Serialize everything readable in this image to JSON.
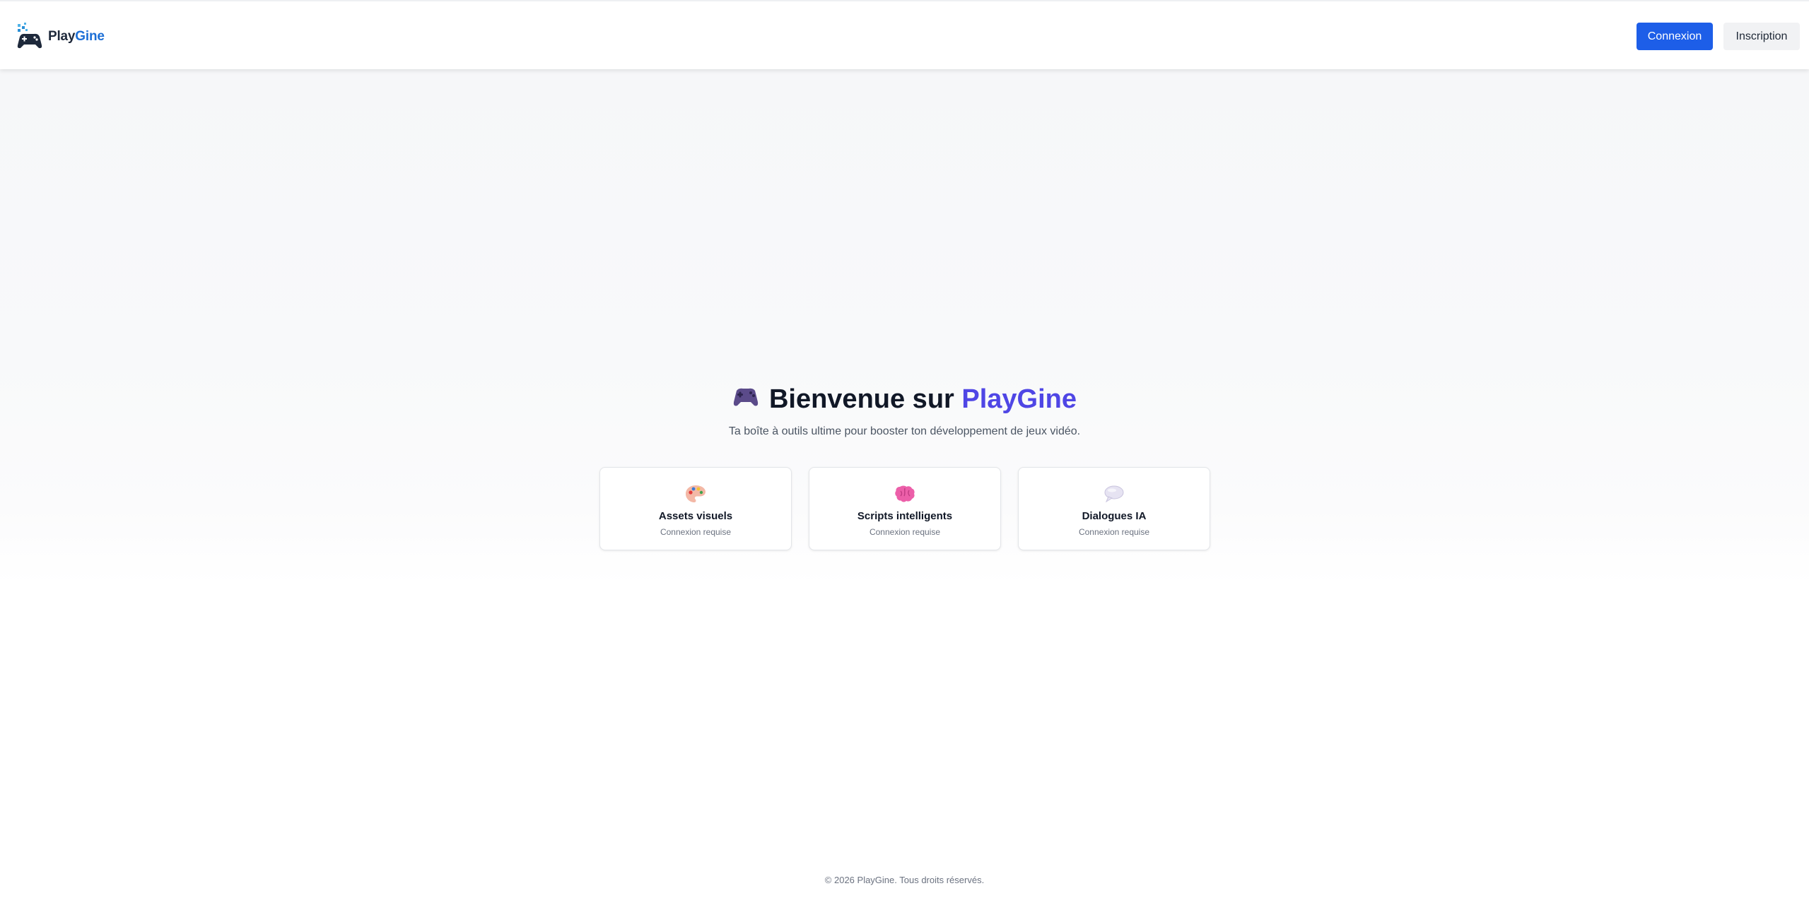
{
  "header": {
    "brand": {
      "name_main": "Play",
      "name_accent": "Gine",
      "icon": "gamepad-logo-icon"
    },
    "login_label": "Connexion",
    "signup_label": "Inscription"
  },
  "hero": {
    "title_icon": "gamepad-emoji-icon",
    "title_prefix": "Bienvenue sur",
    "title_accent": "PlayGine",
    "subtitle": "Ta boîte à outils ultime pour booster ton développement de jeux vidéo."
  },
  "features": [
    {
      "icon": "palette-icon",
      "title": "Assets visuels",
      "status": "Connexion requise"
    },
    {
      "icon": "brain-icon",
      "title": "Scripts intelligents",
      "status": "Connexion requise"
    },
    {
      "icon": "speech-bubble-icon",
      "title": "Dialogues IA",
      "status": "Connexion requise"
    }
  ],
  "footer": {
    "copyright": "© 2026 PlayGine. Tous droits réservés."
  },
  "colors": {
    "primary_button": "#1d5ee8",
    "brand_accent": "#4f46e5",
    "logo_accent": "#1d6fd6"
  }
}
